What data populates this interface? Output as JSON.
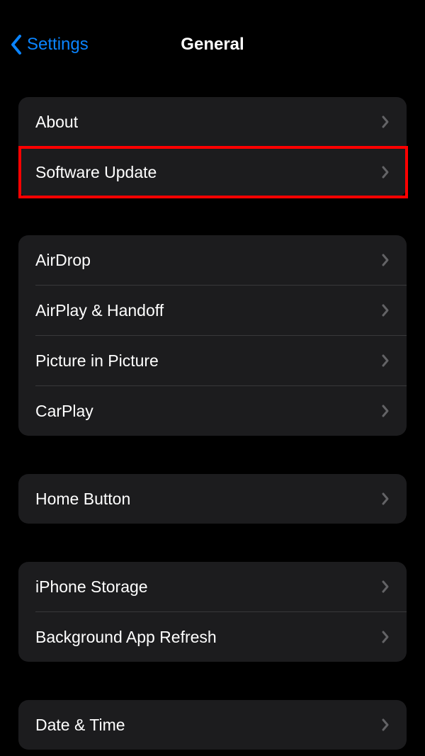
{
  "nav": {
    "back_label": "Settings",
    "title": "General"
  },
  "groups": [
    {
      "rows": [
        {
          "label": "About"
        },
        {
          "label": "Software Update"
        }
      ]
    },
    {
      "rows": [
        {
          "label": "AirDrop"
        },
        {
          "label": "AirPlay & Handoff"
        },
        {
          "label": "Picture in Picture"
        },
        {
          "label": "CarPlay"
        }
      ]
    },
    {
      "rows": [
        {
          "label": "Home Button"
        }
      ]
    },
    {
      "rows": [
        {
          "label": "iPhone Storage"
        },
        {
          "label": "Background App Refresh"
        }
      ]
    },
    {
      "rows": [
        {
          "label": "Date & Time"
        }
      ]
    }
  ],
  "highlight": {
    "color": "#ff0000",
    "target": "Software Update"
  }
}
